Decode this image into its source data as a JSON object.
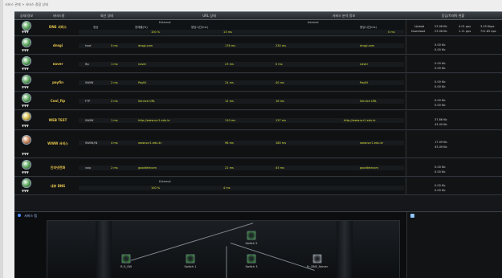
{
  "breadcrumb": "서비스 관제 > 서비스 종합 상태",
  "header": {
    "col_status": "상태/경보",
    "col_name": "서비스명",
    "col_net": "회선 상태",
    "col_url": "URL 상태",
    "col_web": "서비스 분석 정보",
    "col_perf": "응답/트래픽 현황"
  },
  "rows": [
    {
      "name": "DNS 서비스",
      "status": "ok",
      "external": "External",
      "uptime": "100 %",
      "resp": "13 ms",
      "col_ok": "정상",
      "col_err": "장애율(%)",
      "col_resp": "응답시간(ms)",
      "internal": "Internal",
      "int_resp": "0 ms",
      "upload": "Upload",
      "download": "Download",
      "up_v": "23.08 Kb",
      "dn_v": "23.08 Kb",
      "pps1": "4.01 pps",
      "pps2": "1.11 pps",
      "bps1": "3.45 Kbps",
      "bps2": "721.85 bps"
    },
    {
      "name": "dnsgi",
      "status": "ok",
      "l1": "host",
      "l2": "5 ms",
      "l3": "dnsgi.com",
      "l4": "176 ms",
      "l5": "230 ms",
      "l6": "dnsgi.com",
      "up_v": "0.00 Kb",
      "dn_v": "0.00 Kb"
    },
    {
      "name": "naver",
      "status": "ok",
      "l1": "ftp",
      "l2": "1 ms",
      "l3": "naver",
      "l4": "23 ms",
      "l5": "0 ms",
      "l6": "naver",
      "up_v": "0.00 Kb",
      "dn_v": "0.00 Kb"
    },
    {
      "name": "payfin",
      "status": "ok",
      "l1": "WWW",
      "l2": "2 ms",
      "l3": "PayIN",
      "l4": "24 ms",
      "l5": "40 ms",
      "l6": "PayIN",
      "up_v": "0.00 Kb",
      "dn_v": "0.00 Kb"
    },
    {
      "name": "Cool_ftp",
      "status": "ok",
      "l1": "FTP",
      "l2": "2 ms",
      "l3": "Service URL",
      "l4": "12 ms",
      "l5": "16 ms",
      "l6": "Service URL",
      "up_v": "0.00 Kb",
      "dn_v": "0.00 Kb"
    },
    {
      "name": "WEB TEST",
      "status": "warn",
      "l1": "WWW",
      "l2": "1 ms",
      "l3": "http://www.scr1.edu.kr",
      "l4": "110 ms",
      "l5": "137 ms",
      "l6": "http://www.scr1.edu.kr",
      "up_v": "37.86 Kb",
      "dn_v": "43.49 Kb"
    },
    {
      "name": "WWW 서비스",
      "status": "err",
      "l1": "WWW/IN",
      "l2": "4 ms",
      "l3": "www.scr1.edu.kr",
      "l4": "98 ms",
      "l5": "180 ms",
      "l6": "www.scr1.edu.kr",
      "up_v": "17.09 Kb",
      "dn_v": "43.49 Kb"
    },
    {
      "name": "인터넷전화",
      "status": "ok",
      "l1": "voip",
      "l2": "2 ms",
      "l3": "goodtelecom",
      "l4": "22 ms",
      "l5": "43 ms",
      "l6": "goodtelecom",
      "up_v": "0.00 Kb",
      "dn_v": "0.00 Kb"
    },
    {
      "name": "내부 DNS",
      "status": "ok",
      "l1": "External",
      "l2": "100 %",
      "l3": "4 ms",
      "up_v": "0.00 Kb",
      "dn_v": "0.00 Kb"
    }
  ],
  "map": {
    "title": "서비스 맵",
    "nodes": [
      "Switch 2",
      "R-G_SW",
      "Switch 1",
      "Switch 3",
      "Sr_DNS_Server"
    ]
  }
}
